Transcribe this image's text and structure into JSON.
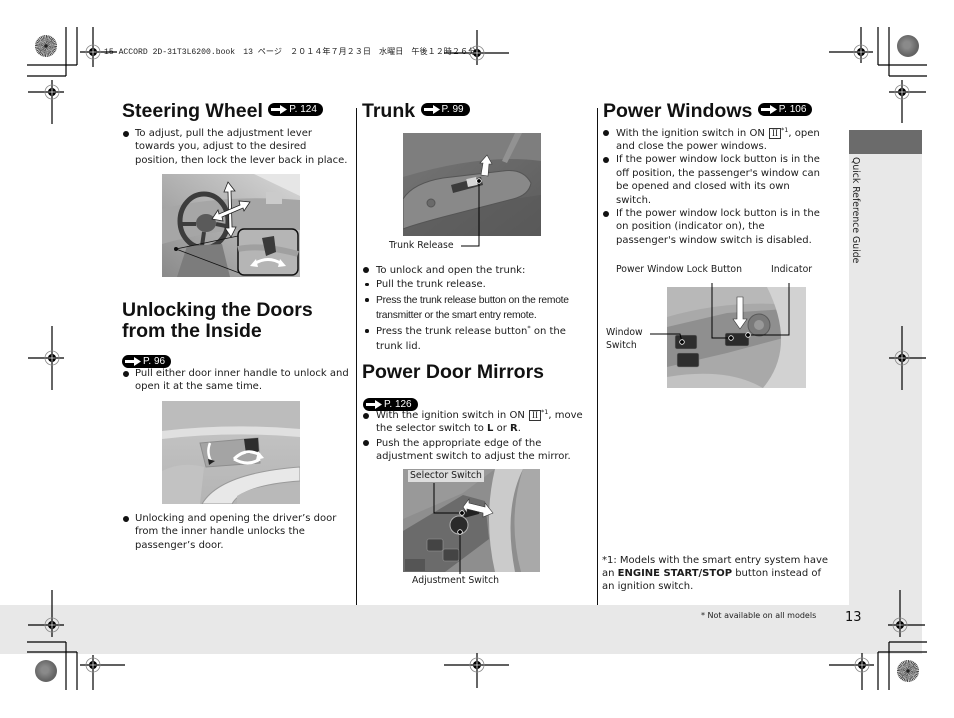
{
  "header": {
    "print_info": "15 ACCORD 2D-31T3L6200.book　13 ページ　２０１４年７月２３日　水曜日　午後１２時２６分"
  },
  "sidebar": {
    "tab_label": "Quick Reference Guide"
  },
  "steering_wheel": {
    "title": "Steering Wheel",
    "ref": "P. 124",
    "bullets": [
      "To adjust, pull the adjustment lever towards you, adjust to the desired position, then lock the lever back in place."
    ]
  },
  "unlocking_doors": {
    "title_line1": "Unlocking the Doors",
    "title_line2": "from the Inside",
    "ref": "P. 96",
    "bullets": [
      "Pull either door inner handle to unlock and open it at the same time.",
      "Unlocking and opening the driver’s door from the inner handle unlocks the passenger’s door."
    ]
  },
  "trunk": {
    "title": "Trunk",
    "ref": "P. 99",
    "callout_release": "Trunk Release",
    "intro": "To unlock and open the trunk:",
    "steps": [
      {
        "text": "Pull the trunk release."
      },
      {
        "text": "Press the trunk release button on the remote transmitter or the smart entry remote."
      },
      {
        "text": "Press the trunk release button",
        "mark": "*",
        "text_after": " on the trunk lid."
      }
    ]
  },
  "power_door_mirrors": {
    "title": "Power Door Mirrors",
    "ref": "P. 126",
    "bullet1": {
      "before": "With the ignition switch in ON",
      "switch_pos": "II",
      "note_ref": "*1",
      "middle": ", move the selector switch to ",
      "bold1": "L",
      "or": " or ",
      "bold2": "R",
      "end": "."
    },
    "bullet2": "Push the appropriate edge of the adjustment switch to adjust the mirror.",
    "callout_selector": "Selector Switch",
    "callout_adjustment": "Adjustment Switch"
  },
  "power_windows": {
    "title": "Power Windows",
    "ref": "P. 106",
    "bullet1": {
      "before": "With the ignition switch in ON",
      "switch_pos": "II",
      "note_ref": "*1",
      "after": ", open and close the power windows."
    },
    "bullets": [
      "If the power window lock button is in the off position, the passenger's window can be opened and closed with its own switch.",
      "If the power window lock button is in the on position (indicator on), the passenger's window switch is disabled."
    ],
    "callout_lock_button": "Power Window Lock Button",
    "callout_indicator": "Indicator",
    "callout_window_switch": "Window Switch"
  },
  "footnote": {
    "marker": "*1:",
    "before": " Models with the smart entry system have an ",
    "bold": "ENGINE START/STOP",
    "after": " button instead of an ignition switch."
  },
  "footer": {
    "availability_note": "* Not available on all models",
    "page_number": "13"
  }
}
